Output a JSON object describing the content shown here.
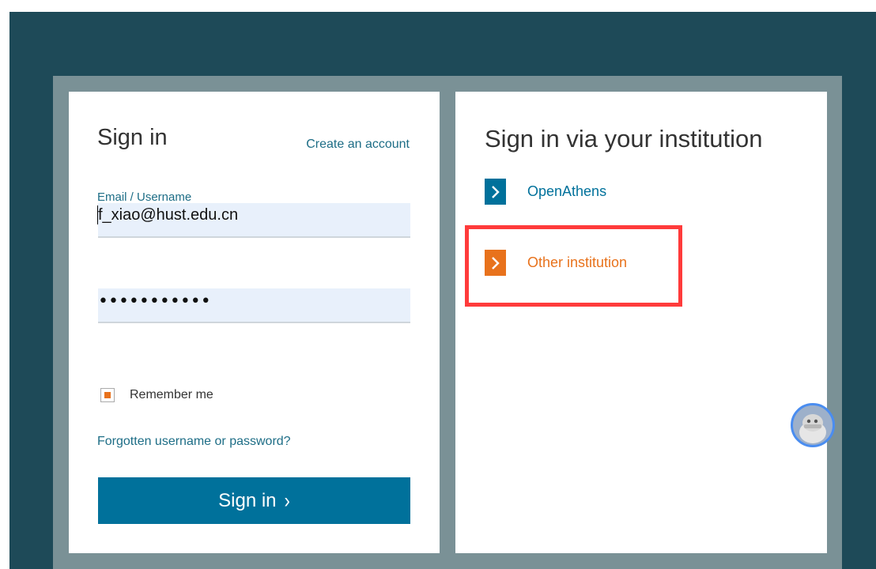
{
  "signin": {
    "title": "Sign in",
    "create_account": "Create an account",
    "email_label": "Email / Username",
    "email_value": "f_xiao@hust.edu.cn",
    "password_mask": "•••••••••••",
    "remember_label": "Remember me",
    "remember_checked": true,
    "forgot_link": "Forgotten username or password?",
    "submit_label": "Sign in",
    "submit_chevron": "›"
  },
  "institution": {
    "title": "Sign in via your institution",
    "options": [
      {
        "label": "OpenAthens",
        "color": "#00719b",
        "icon": "chevron-right-icon"
      },
      {
        "label": "Other institution",
        "color": "#e8721c",
        "icon": "chevron-right-icon",
        "highlighted": true
      }
    ]
  },
  "colors": {
    "page_background": "#1e4a58",
    "frame": "#7a9196",
    "primary": "#00719b",
    "accent": "#e8721c",
    "highlight": "#ff3b3b"
  },
  "chat_widget": {
    "icon": "robot-avatar-icon"
  }
}
